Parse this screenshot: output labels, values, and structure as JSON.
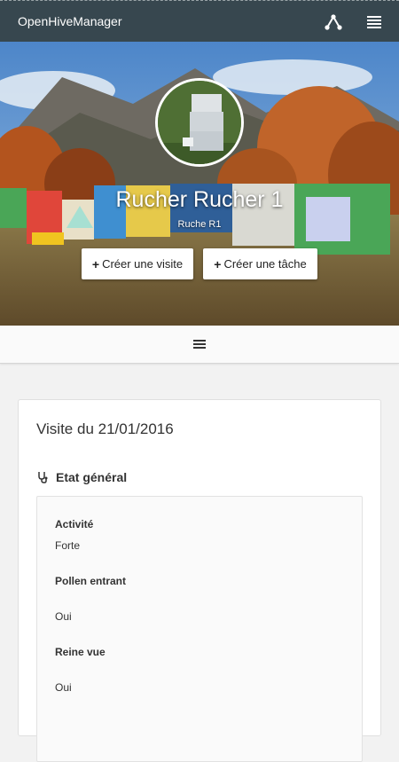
{
  "app": {
    "title": "OpenHiveManager",
    "icons": {
      "share": "share-icon",
      "menu": "menu-icon"
    }
  },
  "hero": {
    "title": "Rucher Rucher 1",
    "subtitle": "Ruche R1",
    "buttons": {
      "create_visit": "Créer une visite",
      "create_task": "Créer une tâche"
    }
  },
  "subbar": {
    "icon": "hamburger-icon"
  },
  "card": {
    "title": "Visite du 21/01/2016",
    "section": {
      "title": "Etat général",
      "icon": "stethoscope-icon",
      "fields": [
        {
          "label": "Activité",
          "value": "Forte"
        },
        {
          "label": "Pollen entrant",
          "value": "Oui"
        },
        {
          "label": "Reine vue",
          "value": "Oui"
        }
      ]
    }
  },
  "colors": {
    "topbar": "#37474f",
    "background": "#f2f2f2"
  }
}
